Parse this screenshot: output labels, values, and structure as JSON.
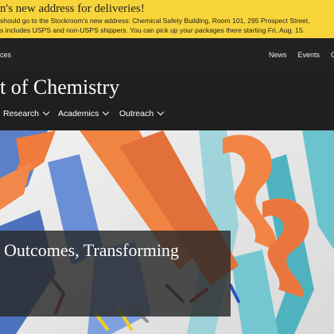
{
  "alert": {
    "title": "n's new address for deliveries!",
    "line1": "should go to the Stockroom's new address: Chemical Safety Building, Room 101, 295 Prospect Street,",
    "line2": "s includes USPS and non-USPS shippers. You can pick up your packages there starting Fri, Aug. 15."
  },
  "topbar": {
    "left_text": "ces",
    "links": [
      "News",
      "Events",
      "Gi"
    ]
  },
  "site_title": "t of Chemistry",
  "nav": {
    "items": [
      "Research",
      "Academics",
      "Outreach"
    ]
  },
  "hero": {
    "caption": "Outcomes, Transforming"
  },
  "colors": {
    "alert_bg": "#f7d43a",
    "dark_bg": "#1f1f1f",
    "ribbon_orange": "#f07a3c",
    "ribbon_teal": "#5fb9c4",
    "ribbon_blue": "#5b7fc9"
  }
}
